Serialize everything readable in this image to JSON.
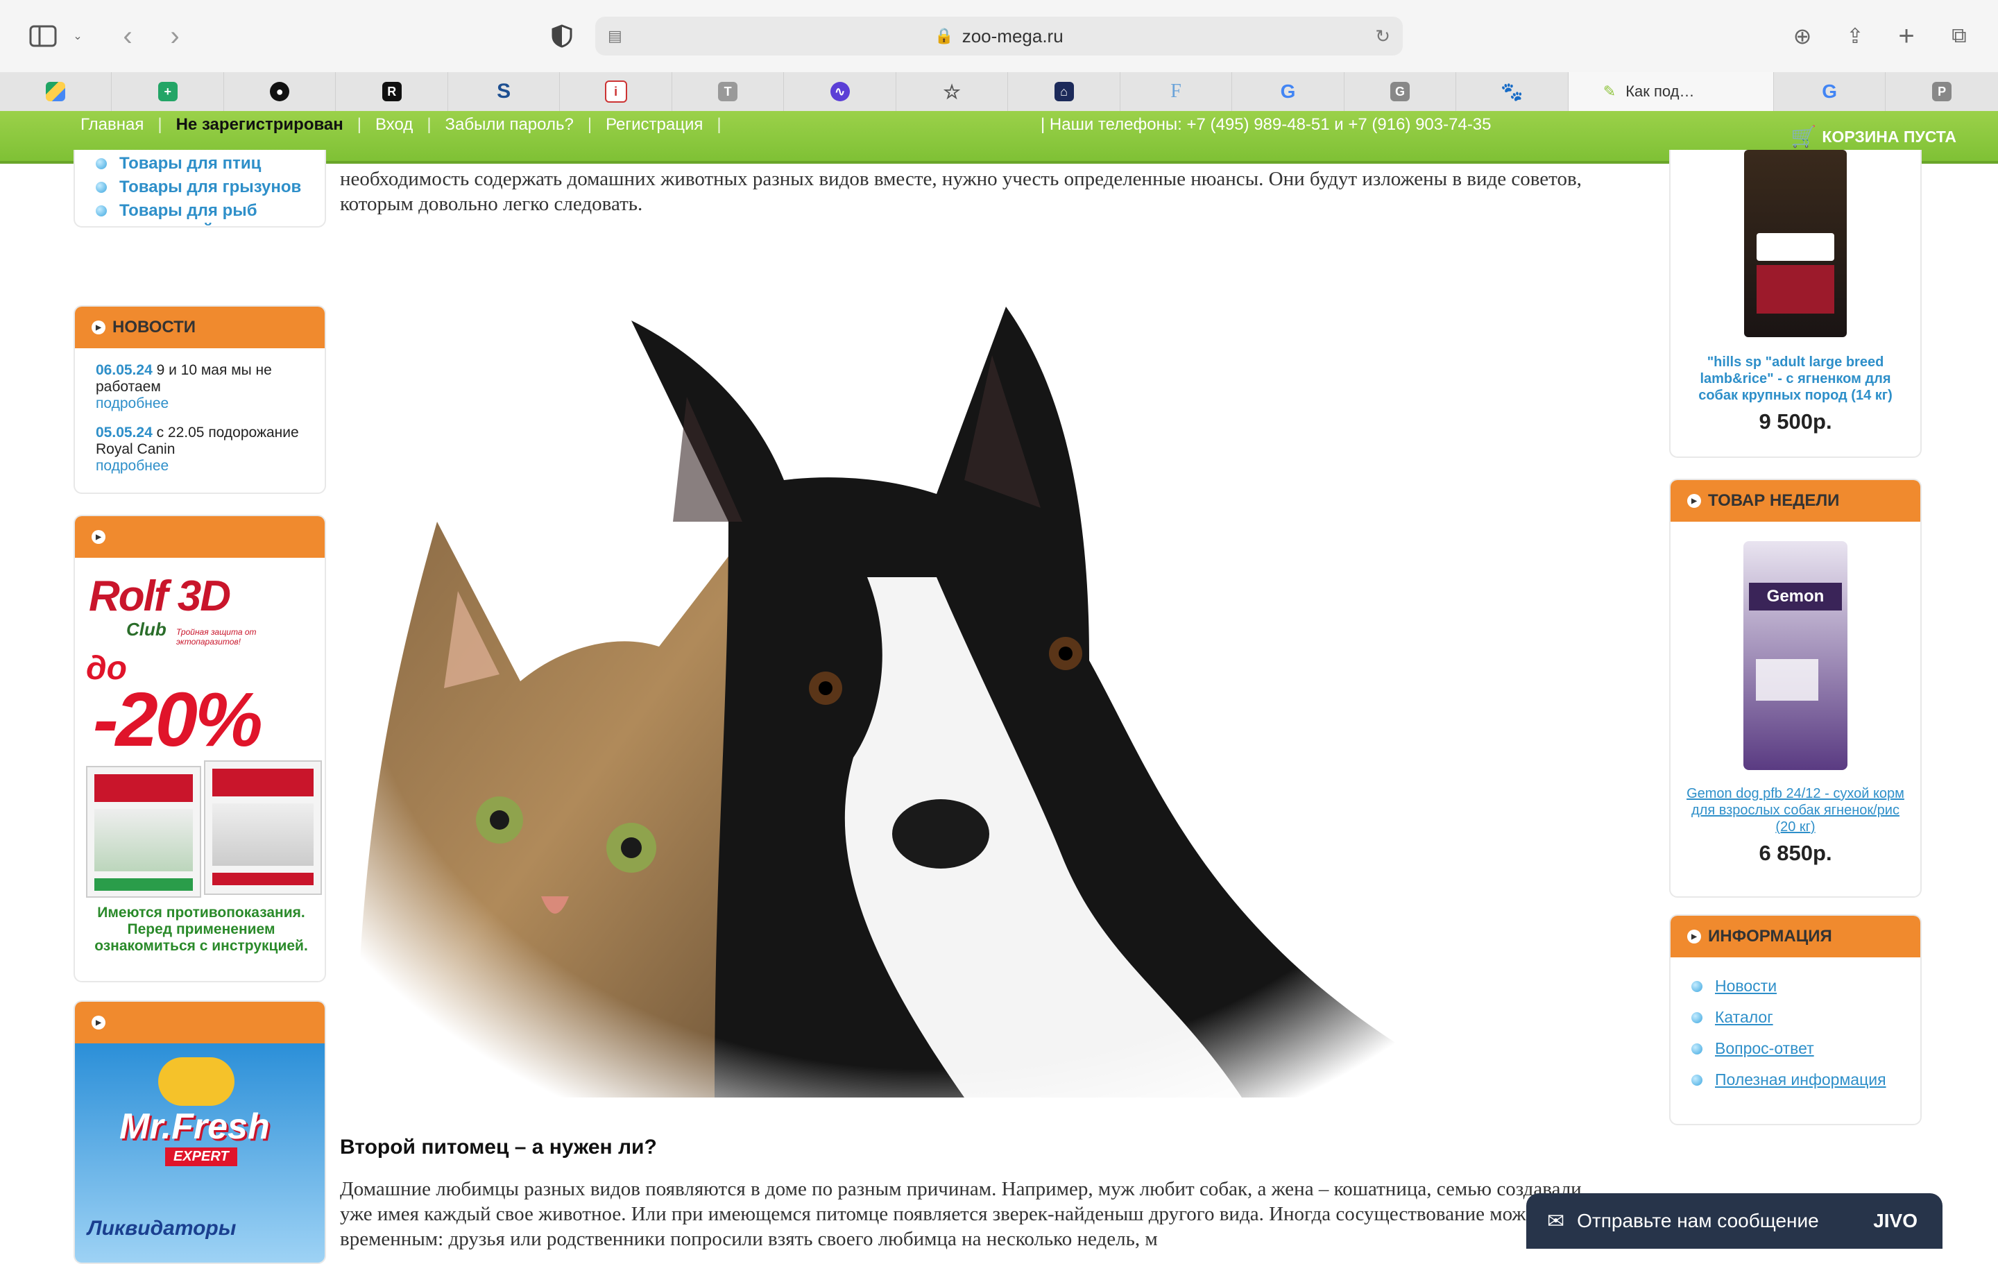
{
  "browser": {
    "url": "zoo-mega.ru",
    "active_tab_title": "Как под…",
    "tab_letters": [
      "",
      "",
      "",
      "R",
      "S",
      "i",
      "T",
      "",
      "☆",
      "",
      "F",
      "G",
      "G",
      "",
      "",
      "P"
    ]
  },
  "site": {
    "nav": [
      "Главная",
      "Не зарегистрирован",
      "Вход",
      "Забыли пароль?",
      "Регистрация"
    ],
    "phones": "| Наши телефоны: +7 (495) 989-48-51 и +7 (916) 903-74-35",
    "cart": "КОРЗИНА ПУСТА"
  },
  "left": {
    "categories": [
      "Товары для птиц",
      "Товары для грызунов",
      "Товары для рыб и рептилий"
    ],
    "news_title": "НОВОСТИ",
    "news": [
      {
        "date": "06.05.24",
        "text": "9 и 10 мая мы не работаем",
        "more": "подробнее"
      },
      {
        "date": "05.05.24",
        "text": "с 22.05 подорожание Royal Canin",
        "more": "подробнее"
      }
    ],
    "banner1": {
      "brand": "Rolf 3D",
      "club": "Club",
      "tagline": "Тройная защита от эктопаразитов!",
      "discount_prefix": "до",
      "discount": "-20%",
      "warning": "Имеются противопоказания. Перед применением ознакомиться с инструкцией."
    },
    "banner2": {
      "brand": "Mr.Fresh",
      "sub": "EXPERT",
      "caption": "Ликвидаторы"
    }
  },
  "main": {
    "intro": "необходимость содержать домашних животных разных видов вместе, нужно учесть определенные нюансы. Они будут изложены в виде советов, которым довольно легко следовать.",
    "heading": "Второй питомец – а нужен ли?",
    "para": "Домашние любимцы разных видов появляются в доме по разным причинам. Например, муж любит собак, а жена – кошатница, семью создавали, уже имея каждый свое животное. Или при имеющемся питомце появляется зверек-найденыш другого вида. Иногда сосуществование может быть временным: друзья или родственники попросили взять своего любимца на несколько недель, м"
  },
  "right": {
    "product1": {
      "name": "\"hills sp \"adult large breed lamb&rice\" - с ягненком для собак крупных пород (14 кг)",
      "price": "9 500р."
    },
    "week_title": "ТОВАР НЕДЕЛИ",
    "product2": {
      "name": "Gemon dog pfb 24/12 - сухой корм для взрослых собак ягненок/рис (20 кг)",
      "price": "6 850р."
    },
    "info_title": "ИНФОРМАЦИЯ",
    "info_links": [
      "Новости",
      "Каталог",
      "Вопрос-ответ",
      "Полезная информация"
    ]
  },
  "chat": {
    "label": "Отправьте нам сообщение",
    "brand": "JIVO"
  }
}
